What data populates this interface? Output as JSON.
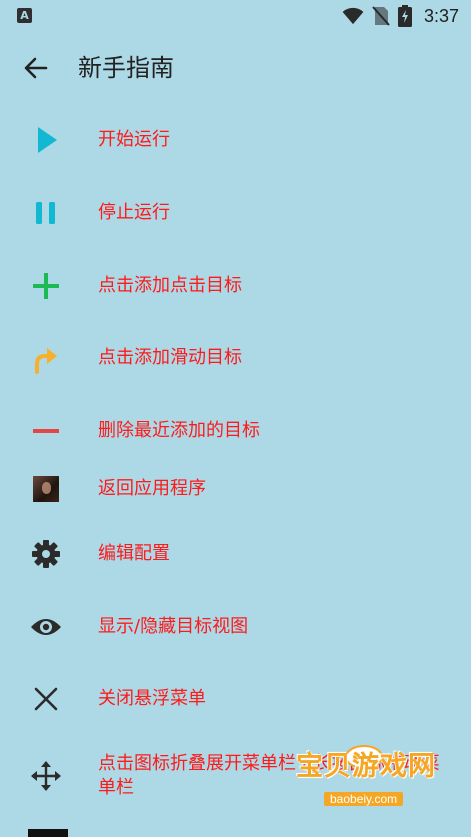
{
  "status_bar": {
    "time": "3:37",
    "notification_icon": "A"
  },
  "toolbar": {
    "title": "新手指南"
  },
  "items": [
    {
      "label": "开始运行",
      "icon": "play-icon"
    },
    {
      "label": "停止运行",
      "icon": "pause-icon"
    },
    {
      "label": "点击添加点击目标",
      "icon": "plus-icon"
    },
    {
      "label": "点击添加滑动目标",
      "icon": "swipe-arrow-icon"
    },
    {
      "label": "删除最近添加的目标",
      "icon": "minus-icon"
    },
    {
      "label": "返回应用程序",
      "icon": "app-thumbnail-icon"
    },
    {
      "label": "编辑配置",
      "icon": "gear-icon"
    },
    {
      "label": "显示/隐藏目标视图",
      "icon": "eye-icon"
    },
    {
      "label": "关闭悬浮菜单",
      "icon": "close-icon"
    },
    {
      "label": "点击图标折叠展开菜单栏 / 长按图标拖动菜单栏",
      "icon": "move-icon"
    }
  ],
  "watermark": {
    "title": "宝贝游戏网",
    "url": "baobeiy.com"
  },
  "colors": {
    "background": "#ADD8E6",
    "label_text": "#FF1A1A",
    "play_cyan": "#12B8D2",
    "plus_green": "#1DB954",
    "swipe_orange": "#F5B02E",
    "minus_red": "#E64545",
    "dark_icon": "#2b2b2b"
  }
}
